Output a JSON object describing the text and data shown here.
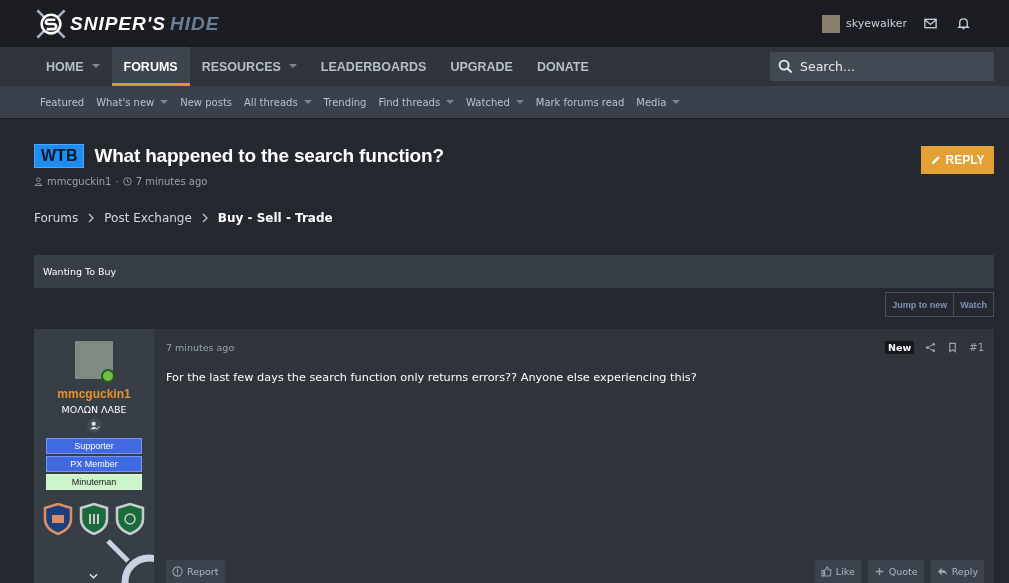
{
  "logo": {
    "first": "SNIPER'S",
    "second": "HIDE"
  },
  "account": {
    "username": "skyewalker"
  },
  "nav": [
    {
      "label": "HOME",
      "has_menu": true,
      "selected": false
    },
    {
      "label": "FORUMS",
      "has_menu": false,
      "selected": true
    },
    {
      "label": "RESOURCES",
      "has_menu": true,
      "selected": false
    },
    {
      "label": "LEADERBOARDS",
      "has_menu": false,
      "selected": false
    },
    {
      "label": "UPGRADE",
      "has_menu": false,
      "selected": false
    },
    {
      "label": "DONATE",
      "has_menu": false,
      "selected": false
    }
  ],
  "search": {
    "placeholder": "Search..."
  },
  "subnav": [
    {
      "label": "Featured",
      "has_menu": false
    },
    {
      "label": "What's new",
      "has_menu": true
    },
    {
      "label": "New posts",
      "has_menu": false
    },
    {
      "label": "All threads",
      "has_menu": true
    },
    {
      "label": "Trending",
      "has_menu": false
    },
    {
      "label": "Find threads",
      "has_menu": true
    },
    {
      "label": "Watched",
      "has_menu": true
    },
    {
      "label": "Mark forums read",
      "has_menu": false
    },
    {
      "label": "Media",
      "has_menu": true
    }
  ],
  "thread": {
    "prefix": "WTB",
    "title": "What happened to the search function?",
    "author": "mmcguckin1",
    "separator": "·",
    "time": "7 minutes ago",
    "reply_button": "REPLY"
  },
  "breadcrumbs": [
    {
      "label": "Forums",
      "current": false
    },
    {
      "label": "Post Exchange",
      "current": false
    },
    {
      "label": "Buy - Sell - Trade",
      "current": true
    }
  ],
  "category_bar": "Wanting To Buy",
  "thread_actions": [
    "Jump to new",
    "Watch"
  ],
  "post": {
    "username": "mmcguckin1",
    "user_title": "ΜΟΛΩΝ ΛΑΒΕ",
    "banners": [
      {
        "label": "Supporter",
        "color": "#4169e1"
      },
      {
        "label": "PX Member",
        "color": "#4169e1"
      },
      {
        "label": "Minuteman",
        "color": "#ccf5cc"
      }
    ],
    "time": "7 minutes ago",
    "new_badge": "New",
    "number": "#1",
    "body": "For the last few days the search function only returns errors?? Anyone else experiencing this?",
    "report": "Report",
    "actions": [
      {
        "kind": "like",
        "label": "Like"
      },
      {
        "kind": "quote",
        "label": "Quote"
      },
      {
        "kind": "reply",
        "label": "Reply"
      }
    ]
  }
}
